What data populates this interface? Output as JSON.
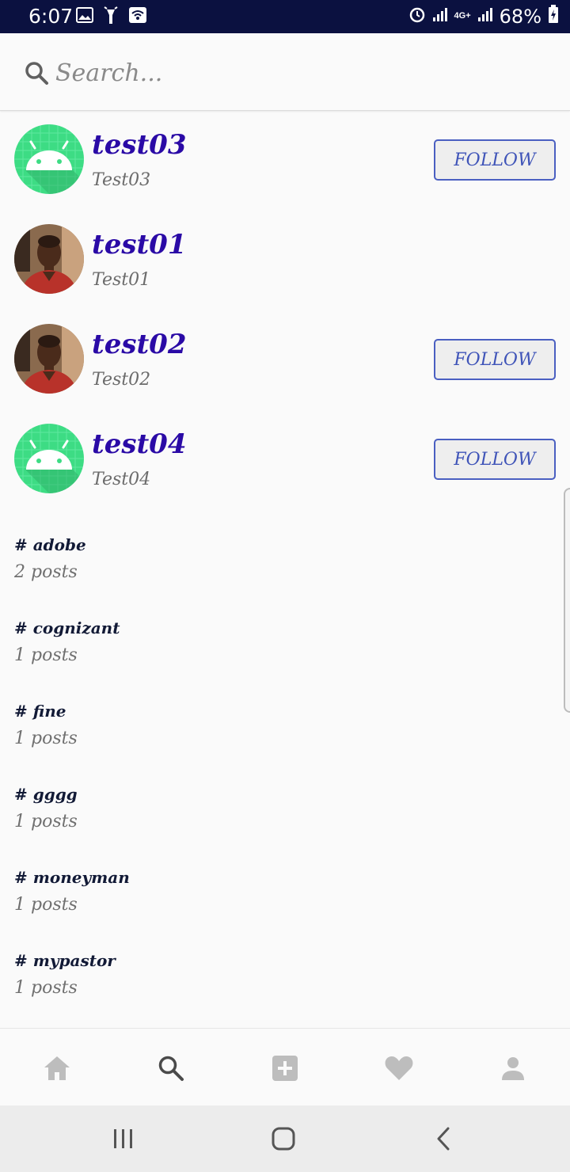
{
  "status_bar": {
    "time": "6:07",
    "network_label": "4G+",
    "battery": "68%"
  },
  "search": {
    "placeholder": "Search..."
  },
  "users": [
    {
      "username": "test03",
      "fullname": "Test03",
      "avatar": "android-logo",
      "follow_label": "FOLLOW",
      "show_follow": true
    },
    {
      "username": "test01",
      "fullname": "Test01",
      "avatar": "photo",
      "follow_label": "",
      "show_follow": false
    },
    {
      "username": "test02",
      "fullname": "Test02",
      "avatar": "photo",
      "follow_label": "FOLLOW",
      "show_follow": true
    },
    {
      "username": "test04",
      "fullname": "Test04",
      "avatar": "android-logo",
      "follow_label": "FOLLOW",
      "show_follow": true
    }
  ],
  "tags": [
    {
      "name": "# adobe",
      "count": "2 posts"
    },
    {
      "name": "# cognizant",
      "count": "1 posts"
    },
    {
      "name": "# fine",
      "count": "1 posts"
    },
    {
      "name": "# gggg",
      "count": "1 posts"
    },
    {
      "name": "# moneyman",
      "count": "1 posts"
    },
    {
      "name": "# mypastor",
      "count": "1 posts"
    }
  ],
  "bottom_nav": [
    {
      "icon": "home-icon",
      "active": false
    },
    {
      "icon": "search-icon",
      "active": true
    },
    {
      "icon": "add-post-icon",
      "active": false
    },
    {
      "icon": "heart-icon",
      "active": false
    },
    {
      "icon": "profile-icon",
      "active": false
    }
  ],
  "colors": {
    "username": "#2a0aa6",
    "follow_border": "#4a5fc1",
    "status_bar": "#0b1140",
    "android_green": "#3ddc84"
  }
}
